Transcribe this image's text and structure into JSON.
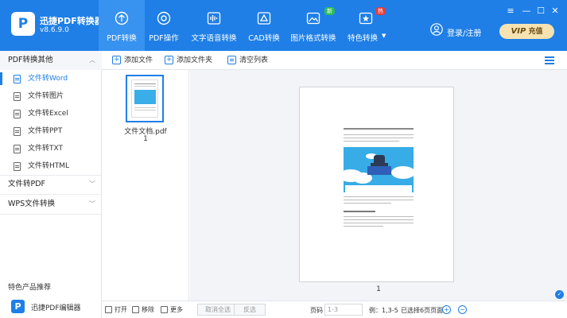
{
  "app": {
    "name": "迅捷PDF转换器",
    "version": "v8.6.9.0"
  },
  "tabs": [
    {
      "label": "PDF转换",
      "icon": "convert-icon",
      "active": true
    },
    {
      "label": "PDF操作",
      "icon": "pdf-operation-icon",
      "active": false
    },
    {
      "label": "文字语音转换",
      "icon": "audio-wave-icon",
      "active": false
    },
    {
      "label": "CAD转换",
      "icon": "cad-icon",
      "active": false
    },
    {
      "label": "图片格式转换",
      "icon": "image-icon",
      "active": false,
      "badge": "新"
    },
    {
      "label": "特色转换",
      "icon": "feature-icon",
      "active": false,
      "badge": "热"
    }
  ],
  "header": {
    "login_label": "登录/注册",
    "vip_label": "VIP",
    "recharge_label": "充值"
  },
  "sidebar": {
    "section1_title": "PDF转换其他",
    "items": [
      {
        "label": "文件转Word",
        "active": true
      },
      {
        "label": "文件转图片",
        "active": false
      },
      {
        "label": "文件转Excel",
        "active": false
      },
      {
        "label": "文件转PPT",
        "active": false
      },
      {
        "label": "文件转TXT",
        "active": false
      },
      {
        "label": "文件转HTML",
        "active": false
      }
    ],
    "section2_title": "文件转PDF",
    "section3_title": "WPS文件转换",
    "promo_title": "特色产品推荐",
    "promo_item": "迅捷PDF编辑器"
  },
  "toolbar": {
    "add_file": "添加文件",
    "add_folder": "添加文件夹",
    "clear_list": "清空列表"
  },
  "file": {
    "name": "文件文档.pdf",
    "pages": "1"
  },
  "preview": {
    "page_number": "1"
  },
  "bottombar": {
    "open": "打开",
    "delete": "移除",
    "more": "更多",
    "cancel_all": "取消全选",
    "invert": "反选",
    "page_label": "页码",
    "page_placeholder": "1-3",
    "example": "例：1,3-5",
    "selected_pages": "已选择6页页面"
  }
}
